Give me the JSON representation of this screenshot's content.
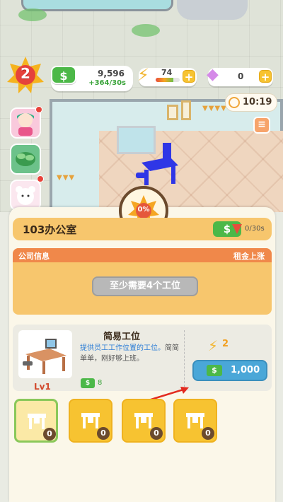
{
  "hud": {
    "level": "2",
    "money": {
      "value": "9,596",
      "rate": "+364/30s",
      "icon": "dollar-icon"
    },
    "energy": {
      "value": "74",
      "level_fraction": 0.74,
      "icon": "bolt-icon"
    },
    "gems": {
      "value": "0",
      "icon": "diamond-icon"
    },
    "timer": {
      "value": "10:19",
      "icon": "clock-icon"
    }
  },
  "room": {
    "name": "103办公室",
    "income_rate": "0/30s",
    "progress_percent": "0%",
    "info_tab": "公司信息",
    "info_right": "租金上涨",
    "requirement": "至少需要4个工位"
  },
  "item": {
    "name": "简易工位",
    "desc_highlight": "提供员工工作位置的工位。",
    "desc_rest": "简简单单，刚好够上班。",
    "level": "Lv1",
    "income": "8",
    "cost_energy": "2",
    "cost_money": "1,000"
  },
  "slots": [
    {
      "count": "0",
      "selected": true
    },
    {
      "count": "0",
      "selected": false
    },
    {
      "count": "0",
      "selected": false
    },
    {
      "count": "0",
      "selected": false
    }
  ],
  "colors": {
    "panel_header": "#f7c66d",
    "info_head": "#f0884a",
    "buy_button": "#4aa7d8",
    "money_green": "#4cb848",
    "slot_yellow": "#f7c331"
  }
}
